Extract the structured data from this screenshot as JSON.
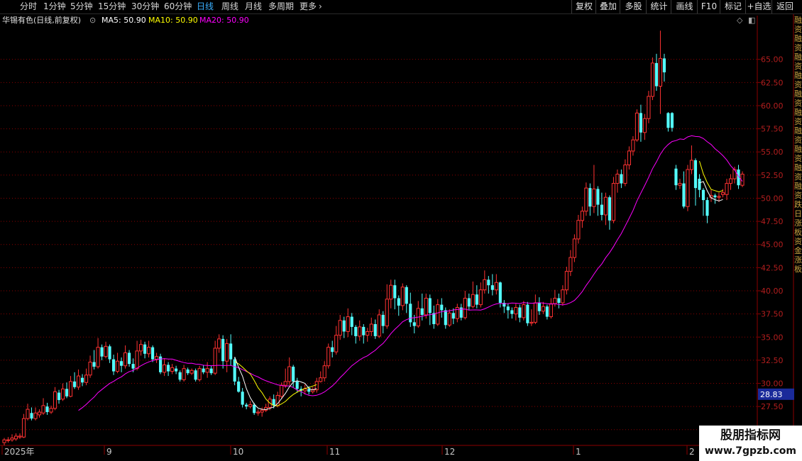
{
  "toolbar": {
    "periods": [
      "分时",
      "1分钟",
      "5分钟",
      "15分钟",
      "30分钟",
      "60分钟",
      "日线",
      "周线",
      "月线",
      "多周期",
      "更多"
    ],
    "active_period": "日线",
    "right_buttons": [
      "复权",
      "叠加",
      "多股",
      "统计",
      "画线",
      "F10",
      "标记",
      "+自选",
      "返回"
    ]
  },
  "info": {
    "title": "华锡有色(日线,前复权)",
    "ma5": "MA5: 50.90",
    "ma10": "MA10: 50.90",
    "ma20": "MA20: 50.90"
  },
  "colors": {
    "up": "#ff3232",
    "down": "#54ffff",
    "ma5": "#ffffff",
    "ma10": "#ffff00",
    "ma20": "#ff00ff",
    "grid": "#8b0000",
    "price_tag_bg": "#1a2a9a"
  },
  "chart_data": {
    "type": "candlestick",
    "title": "华锡有色(日线,前复权)",
    "y_ticks": [
      "65.00",
      "62.50",
      "60.00",
      "57.50",
      "55.00",
      "52.50",
      "50.00",
      "47.50",
      "45.00",
      "42.50",
      "40.00",
      "37.50",
      "35.00",
      "32.50",
      "30.00",
      "27.50",
      "25.00"
    ],
    "ylim": [
      23.3,
      68.5
    ],
    "x_ticks": [
      "2025年",
      "9",
      "10",
      "11",
      "12",
      "1",
      "2"
    ],
    "current_price_tag": "28.83",
    "candles": [
      {
        "o": 23.6,
        "c": 23.9,
        "h": 24.1,
        "l": 23.3
      },
      {
        "o": 23.9,
        "c": 23.9,
        "h": 24.2,
        "l": 23.6
      },
      {
        "o": 23.9,
        "c": 24.1,
        "h": 24.5,
        "l": 23.7
      },
      {
        "o": 24.0,
        "c": 24.3,
        "h": 24.6,
        "l": 23.8
      },
      {
        "o": 24.2,
        "c": 24.3,
        "h": 24.6,
        "l": 24.0
      },
      {
        "o": 24.2,
        "c": 26.2,
        "h": 26.7,
        "l": 24.1
      },
      {
        "o": 26.2,
        "c": 27.2,
        "h": 27.8,
        "l": 26.0
      },
      {
        "o": 26.8,
        "c": 26.2,
        "h": 27.4,
        "l": 26.0
      },
      {
        "o": 26.2,
        "c": 26.8,
        "h": 27.4,
        "l": 26.0
      },
      {
        "o": 26.6,
        "c": 26.9,
        "h": 27.2,
        "l": 26.3
      },
      {
        "o": 26.8,
        "c": 27.6,
        "h": 28.4,
        "l": 26.6
      },
      {
        "o": 27.5,
        "c": 26.9,
        "h": 27.9,
        "l": 26.6
      },
      {
        "o": 26.9,
        "c": 27.3,
        "h": 27.6,
        "l": 26.7
      },
      {
        "o": 27.3,
        "c": 29.1,
        "h": 29.6,
        "l": 27.1
      },
      {
        "o": 29.0,
        "c": 28.2,
        "h": 29.3,
        "l": 27.8
      },
      {
        "o": 28.3,
        "c": 29.4,
        "h": 30.0,
        "l": 28.1
      },
      {
        "o": 29.4,
        "c": 28.6,
        "h": 30.1,
        "l": 28.4
      },
      {
        "o": 28.6,
        "c": 30.2,
        "h": 30.8,
        "l": 28.5
      },
      {
        "o": 30.2,
        "c": 29.6,
        "h": 31.2,
        "l": 29.4
      },
      {
        "o": 29.6,
        "c": 30.8,
        "h": 31.5,
        "l": 29.3
      },
      {
        "o": 30.6,
        "c": 30.1,
        "h": 31.0,
        "l": 29.7
      },
      {
        "o": 30.1,
        "c": 30.9,
        "h": 31.6,
        "l": 29.8
      },
      {
        "o": 30.9,
        "c": 32.3,
        "h": 33.0,
        "l": 30.6
      },
      {
        "o": 32.3,
        "c": 31.8,
        "h": 33.6,
        "l": 31.5
      },
      {
        "o": 31.8,
        "c": 33.9,
        "h": 34.9,
        "l": 31.6
      },
      {
        "o": 33.9,
        "c": 32.9,
        "h": 34.2,
        "l": 32.5
      },
      {
        "o": 32.9,
        "c": 34.0,
        "h": 34.5,
        "l": 32.7
      },
      {
        "o": 34.0,
        "c": 32.6,
        "h": 34.2,
        "l": 32.2
      },
      {
        "o": 32.6,
        "c": 31.3,
        "h": 33.1,
        "l": 30.9
      },
      {
        "o": 31.3,
        "c": 32.4,
        "h": 33.3,
        "l": 31.1
      },
      {
        "o": 32.4,
        "c": 31.9,
        "h": 32.8,
        "l": 31.2
      },
      {
        "o": 31.9,
        "c": 33.3,
        "h": 34.1,
        "l": 31.6
      },
      {
        "o": 33.3,
        "c": 32.1,
        "h": 33.6,
        "l": 31.8
      },
      {
        "o": 32.1,
        "c": 31.6,
        "h": 32.7,
        "l": 31.2
      },
      {
        "o": 31.6,
        "c": 33.5,
        "h": 34.6,
        "l": 31.4
      },
      {
        "o": 33.5,
        "c": 34.2,
        "h": 34.7,
        "l": 33.0
      },
      {
        "o": 34.2,
        "c": 33.2,
        "h": 34.5,
        "l": 32.7
      },
      {
        "o": 33.2,
        "c": 33.9,
        "h": 34.6,
        "l": 32.8
      },
      {
        "o": 33.9,
        "c": 32.6,
        "h": 34.1,
        "l": 32.3
      },
      {
        "o": 32.6,
        "c": 32.9,
        "h": 33.3,
        "l": 32.2
      },
      {
        "o": 32.9,
        "c": 31.2,
        "h": 33.2,
        "l": 31.0
      },
      {
        "o": 31.2,
        "c": 32.0,
        "h": 32.7,
        "l": 30.8
      },
      {
        "o": 32.0,
        "c": 31.3,
        "h": 32.3,
        "l": 30.8
      },
      {
        "o": 31.3,
        "c": 31.7,
        "h": 32.1,
        "l": 31.0
      },
      {
        "o": 31.6,
        "c": 31.3,
        "h": 31.9,
        "l": 31.0
      },
      {
        "o": 31.2,
        "c": 30.4,
        "h": 31.4,
        "l": 30.2
      },
      {
        "o": 30.4,
        "c": 31.6,
        "h": 32.0,
        "l": 30.2
      },
      {
        "o": 31.5,
        "c": 31.1,
        "h": 31.7,
        "l": 30.9
      },
      {
        "o": 31.1,
        "c": 31.4,
        "h": 31.6,
        "l": 30.9
      },
      {
        "o": 31.4,
        "c": 30.4,
        "h": 31.6,
        "l": 30.2
      },
      {
        "o": 30.4,
        "c": 31.6,
        "h": 31.9,
        "l": 30.2
      },
      {
        "o": 31.6,
        "c": 31.2,
        "h": 32.0,
        "l": 31.0
      },
      {
        "o": 31.2,
        "c": 31.6,
        "h": 32.3,
        "l": 30.6
      },
      {
        "o": 31.6,
        "c": 31.1,
        "h": 31.9,
        "l": 30.9
      },
      {
        "o": 31.1,
        "c": 33.8,
        "h": 34.6,
        "l": 30.9
      },
      {
        "o": 33.8,
        "c": 34.8,
        "h": 35.3,
        "l": 33.3
      },
      {
        "o": 34.8,
        "c": 32.4,
        "h": 35.2,
        "l": 31.6
      },
      {
        "o": 32.4,
        "c": 34.3,
        "h": 34.8,
        "l": 31.2
      },
      {
        "o": 34.3,
        "c": 32.6,
        "h": 35.3,
        "l": 31.9
      },
      {
        "o": 32.6,
        "c": 30.2,
        "h": 32.8,
        "l": 29.8
      },
      {
        "o": 30.2,
        "c": 29.1,
        "h": 30.7,
        "l": 29.0
      },
      {
        "o": 29.1,
        "c": 27.7,
        "h": 29.5,
        "l": 27.4
      },
      {
        "o": 27.7,
        "c": 27.5,
        "h": 27.9,
        "l": 27.2
      },
      {
        "o": 27.5,
        "c": 27.7,
        "h": 28.1,
        "l": 27.3
      },
      {
        "o": 27.7,
        "c": 26.8,
        "h": 27.9,
        "l": 26.6
      },
      {
        "o": 26.8,
        "c": 26.9,
        "h": 27.2,
        "l": 26.5
      },
      {
        "o": 26.9,
        "c": 27.1,
        "h": 27.4,
        "l": 26.4
      },
      {
        "o": 27.1,
        "c": 27.4,
        "h": 27.8,
        "l": 26.9
      },
      {
        "o": 27.4,
        "c": 28.3,
        "h": 28.6,
        "l": 27.1
      },
      {
        "o": 28.3,
        "c": 27.6,
        "h": 28.8,
        "l": 27.3
      },
      {
        "o": 27.6,
        "c": 28.7,
        "h": 29.1,
        "l": 27.4
      },
      {
        "o": 28.6,
        "c": 29.8,
        "h": 30.1,
        "l": 28.3
      },
      {
        "o": 29.8,
        "c": 30.2,
        "h": 31.6,
        "l": 29.5
      },
      {
        "o": 30.2,
        "c": 31.8,
        "h": 32.8,
        "l": 29.8
      },
      {
        "o": 31.8,
        "c": 30.2,
        "h": 32.0,
        "l": 29.6
      },
      {
        "o": 30.2,
        "c": 29.4,
        "h": 30.6,
        "l": 29.0
      },
      {
        "o": 29.4,
        "c": 29.2,
        "h": 29.7,
        "l": 28.6
      },
      {
        "o": 29.2,
        "c": 29.4,
        "h": 29.9,
        "l": 28.8
      },
      {
        "o": 29.4,
        "c": 29.1,
        "h": 29.7,
        "l": 28.8
      },
      {
        "o": 29.1,
        "c": 29.3,
        "h": 29.6,
        "l": 28.9
      },
      {
        "o": 29.3,
        "c": 30.2,
        "h": 30.6,
        "l": 29.0
      },
      {
        "o": 30.2,
        "c": 30.6,
        "h": 31.3,
        "l": 30.1
      },
      {
        "o": 30.6,
        "c": 31.9,
        "h": 32.4,
        "l": 30.2
      },
      {
        "o": 31.9,
        "c": 33.9,
        "h": 34.3,
        "l": 31.6
      },
      {
        "o": 33.9,
        "c": 33.4,
        "h": 34.6,
        "l": 32.8
      },
      {
        "o": 33.4,
        "c": 35.2,
        "h": 36.2,
        "l": 33.1
      },
      {
        "o": 35.2,
        "c": 36.8,
        "h": 37.4,
        "l": 34.7
      },
      {
        "o": 36.8,
        "c": 35.6,
        "h": 37.2,
        "l": 34.9
      },
      {
        "o": 35.6,
        "c": 37.2,
        "h": 38.1,
        "l": 35.0
      },
      {
        "o": 37.2,
        "c": 36.1,
        "h": 37.6,
        "l": 35.2
      },
      {
        "o": 36.1,
        "c": 35.1,
        "h": 36.3,
        "l": 34.3
      },
      {
        "o": 35.1,
        "c": 36.1,
        "h": 36.8,
        "l": 34.6
      },
      {
        "o": 36.1,
        "c": 35.2,
        "h": 36.4,
        "l": 34.3
      },
      {
        "o": 35.2,
        "c": 35.6,
        "h": 36.0,
        "l": 34.5
      },
      {
        "o": 35.6,
        "c": 36.4,
        "h": 37.1,
        "l": 35.1
      },
      {
        "o": 36.4,
        "c": 35.1,
        "h": 36.9,
        "l": 34.8
      },
      {
        "o": 35.1,
        "c": 37.4,
        "h": 38.0,
        "l": 34.9
      },
      {
        "o": 37.4,
        "c": 36.2,
        "h": 37.8,
        "l": 35.4
      },
      {
        "o": 36.2,
        "c": 39.1,
        "h": 40.7,
        "l": 35.9
      },
      {
        "o": 39.1,
        "c": 40.6,
        "h": 41.2,
        "l": 38.1
      },
      {
        "o": 40.6,
        "c": 39.2,
        "h": 41.2,
        "l": 38.0
      },
      {
        "o": 39.2,
        "c": 38.4,
        "h": 39.5,
        "l": 37.3
      },
      {
        "o": 38.4,
        "c": 40.4,
        "h": 40.8,
        "l": 37.9
      },
      {
        "o": 40.4,
        "c": 38.6,
        "h": 40.6,
        "l": 37.6
      },
      {
        "o": 38.6,
        "c": 36.6,
        "h": 39.8,
        "l": 36.1
      },
      {
        "o": 36.6,
        "c": 36.2,
        "h": 37.4,
        "l": 35.4
      },
      {
        "o": 36.2,
        "c": 38.1,
        "h": 38.9,
        "l": 36.0
      },
      {
        "o": 38.1,
        "c": 37.4,
        "h": 39.7,
        "l": 36.8
      },
      {
        "o": 37.4,
        "c": 39.2,
        "h": 39.7,
        "l": 37.0
      },
      {
        "o": 39.2,
        "c": 37.6,
        "h": 39.6,
        "l": 36.3
      },
      {
        "o": 37.6,
        "c": 36.4,
        "h": 38.4,
        "l": 35.9
      },
      {
        "o": 36.4,
        "c": 38.5,
        "h": 39.1,
        "l": 36.2
      },
      {
        "o": 38.5,
        "c": 37.9,
        "h": 39.2,
        "l": 37.1
      },
      {
        "o": 37.9,
        "c": 36.3,
        "h": 38.2,
        "l": 35.9
      },
      {
        "o": 36.3,
        "c": 37.6,
        "h": 38.0,
        "l": 36.1
      },
      {
        "o": 37.6,
        "c": 37.0,
        "h": 38.1,
        "l": 36.4
      },
      {
        "o": 37.0,
        "c": 38.2,
        "h": 38.6,
        "l": 36.6
      },
      {
        "o": 38.2,
        "c": 37.1,
        "h": 38.6,
        "l": 36.8
      },
      {
        "o": 37.1,
        "c": 39.2,
        "h": 40.0,
        "l": 36.9
      },
      {
        "o": 39.2,
        "c": 38.3,
        "h": 39.7,
        "l": 37.9
      },
      {
        "o": 38.3,
        "c": 39.6,
        "h": 41.0,
        "l": 38.1
      },
      {
        "o": 39.6,
        "c": 38.5,
        "h": 40.6,
        "l": 38.1
      },
      {
        "o": 38.5,
        "c": 40.1,
        "h": 40.9,
        "l": 38.2
      },
      {
        "o": 40.1,
        "c": 41.2,
        "h": 42.2,
        "l": 39.7
      },
      {
        "o": 41.2,
        "c": 40.6,
        "h": 41.6,
        "l": 39.7
      },
      {
        "o": 40.6,
        "c": 40.1,
        "h": 41.8,
        "l": 39.5
      },
      {
        "o": 40.1,
        "c": 40.9,
        "h": 41.8,
        "l": 39.6
      },
      {
        "o": 40.9,
        "c": 38.7,
        "h": 41.0,
        "l": 38.2
      },
      {
        "o": 38.7,
        "c": 38.3,
        "h": 39.0,
        "l": 37.6
      },
      {
        "o": 38.3,
        "c": 37.9,
        "h": 38.6,
        "l": 37.0
      },
      {
        "o": 37.9,
        "c": 37.5,
        "h": 38.2,
        "l": 37.0
      },
      {
        "o": 37.5,
        "c": 38.2,
        "h": 38.6,
        "l": 36.8
      },
      {
        "o": 38.2,
        "c": 37.1,
        "h": 38.5,
        "l": 36.6
      },
      {
        "o": 37.1,
        "c": 38.5,
        "h": 38.9,
        "l": 36.8
      },
      {
        "o": 38.5,
        "c": 36.5,
        "h": 38.8,
        "l": 36.2
      },
      {
        "o": 36.5,
        "c": 36.6,
        "h": 38.0,
        "l": 36.2
      },
      {
        "o": 36.6,
        "c": 38.7,
        "h": 39.6,
        "l": 36.4
      },
      {
        "o": 38.7,
        "c": 37.8,
        "h": 39.3,
        "l": 37.4
      },
      {
        "o": 37.8,
        "c": 38.3,
        "h": 38.8,
        "l": 37.5
      },
      {
        "o": 38.3,
        "c": 37.2,
        "h": 38.5,
        "l": 36.9
      },
      {
        "o": 37.2,
        "c": 38.6,
        "h": 39.2,
        "l": 37.0
      },
      {
        "o": 38.6,
        "c": 39.2,
        "h": 40.1,
        "l": 38.3
      },
      {
        "o": 39.2,
        "c": 38.7,
        "h": 39.7,
        "l": 38.1
      },
      {
        "o": 38.7,
        "c": 40.1,
        "h": 40.6,
        "l": 38.4
      },
      {
        "o": 40.1,
        "c": 42.1,
        "h": 42.6,
        "l": 39.6
      },
      {
        "o": 42.1,
        "c": 43.6,
        "h": 44.4,
        "l": 41.6
      },
      {
        "o": 43.6,
        "c": 45.6,
        "h": 46.1,
        "l": 43.1
      },
      {
        "o": 45.6,
        "c": 47.6,
        "h": 48.2,
        "l": 45.1
      },
      {
        "o": 47.6,
        "c": 48.6,
        "h": 49.1,
        "l": 46.8
      },
      {
        "o": 48.6,
        "c": 51.1,
        "h": 51.7,
        "l": 48.1
      },
      {
        "o": 51.1,
        "c": 49.1,
        "h": 51.6,
        "l": 48.1
      },
      {
        "o": 49.1,
        "c": 51.0,
        "h": 53.6,
        "l": 48.4
      },
      {
        "o": 51.0,
        "c": 49.3,
        "h": 51.3,
        "l": 48.1
      },
      {
        "o": 49.3,
        "c": 48.2,
        "h": 50.6,
        "l": 47.6
      },
      {
        "o": 48.2,
        "c": 50.1,
        "h": 50.6,
        "l": 47.1
      },
      {
        "o": 50.1,
        "c": 47.6,
        "h": 50.3,
        "l": 46.6
      },
      {
        "o": 47.6,
        "c": 51.6,
        "h": 52.3,
        "l": 47.3
      },
      {
        "o": 51.6,
        "c": 52.6,
        "h": 53.1,
        "l": 50.6
      },
      {
        "o": 52.6,
        "c": 51.6,
        "h": 53.1,
        "l": 51.1
      },
      {
        "o": 51.6,
        "c": 53.6,
        "h": 54.2,
        "l": 51.3
      },
      {
        "o": 53.6,
        "c": 55.1,
        "h": 55.6,
        "l": 53.1
      },
      {
        "o": 55.1,
        "c": 56.3,
        "h": 56.7,
        "l": 54.6
      },
      {
        "o": 56.3,
        "c": 59.2,
        "h": 59.6,
        "l": 56.1
      },
      {
        "o": 59.2,
        "c": 57.1,
        "h": 60.1,
        "l": 56.1
      },
      {
        "o": 57.1,
        "c": 58.6,
        "h": 59.1,
        "l": 56.3
      },
      {
        "o": 58.6,
        "c": 61.0,
        "h": 61.6,
        "l": 58.1
      },
      {
        "o": 61.0,
        "c": 64.6,
        "h": 65.2,
        "l": 60.6
      },
      {
        "o": 64.6,
        "c": 62.1,
        "h": 65.6,
        "l": 61.6
      },
      {
        "o": 62.1,
        "c": 65.1,
        "h": 68.1,
        "l": 59.1
      },
      {
        "o": 65.1,
        "c": 63.6,
        "h": 65.6,
        "l": 62.6
      },
      {
        "o": 59.2,
        "c": 57.6,
        "h": 59.3,
        "l": 57.2
      },
      {
        "o": 59.2,
        "c": 57.6,
        "h": 59.3,
        "l": 57.2
      },
      {
        "o": 53.2,
        "c": 51.4,
        "h": 53.6,
        "l": 50.9
      },
      {
        "o": 51.4,
        "c": 51.6,
        "h": 52.1,
        "l": 51.0
      },
      {
        "o": 51.6,
        "c": 49.1,
        "h": 52.9,
        "l": 48.9
      },
      {
        "o": 49.1,
        "c": 53.1,
        "h": 53.6,
        "l": 48.6
      },
      {
        "o": 53.1,
        "c": 54.1,
        "h": 55.7,
        "l": 52.6
      },
      {
        "o": 54.1,
        "c": 51.1,
        "h": 54.3,
        "l": 49.2
      },
      {
        "o": 52.1,
        "c": 50.9,
        "h": 52.6,
        "l": 50.1
      },
      {
        "o": 50.9,
        "c": 49.8,
        "h": 51.1,
        "l": 48.1
      },
      {
        "o": 49.8,
        "c": 48.1,
        "h": 50.1,
        "l": 47.3
      },
      {
        "o": 50.1,
        "c": 50.3,
        "h": 50.9,
        "l": 49.6
      },
      {
        "o": 50.3,
        "c": 50.1,
        "h": 50.5,
        "l": 49.4
      },
      {
        "o": 50.1,
        "c": 50.2,
        "h": 50.6,
        "l": 49.6
      },
      {
        "o": 50.4,
        "c": 50.6,
        "h": 51.0,
        "l": 50.1
      },
      {
        "o": 50.4,
        "c": 51.6,
        "h": 52.1,
        "l": 49.8
      },
      {
        "o": 51.6,
        "c": 52.1,
        "h": 52.6,
        "l": 50.9
      },
      {
        "o": 52.1,
        "c": 53.1,
        "h": 53.4,
        "l": 51.6
      },
      {
        "o": 53.1,
        "c": 51.4,
        "h": 53.6,
        "l": 51.0
      },
      {
        "o": 51.4,
        "c": 52.6,
        "h": 52.9,
        "l": 51.2
      }
    ]
  },
  "side_text": "融资融资融资融资融资融资融资融资融资融资跌日涨板资金涨板",
  "watermark": {
    "line1": "股朋指标网",
    "line2": "www.7gpzb.com"
  }
}
